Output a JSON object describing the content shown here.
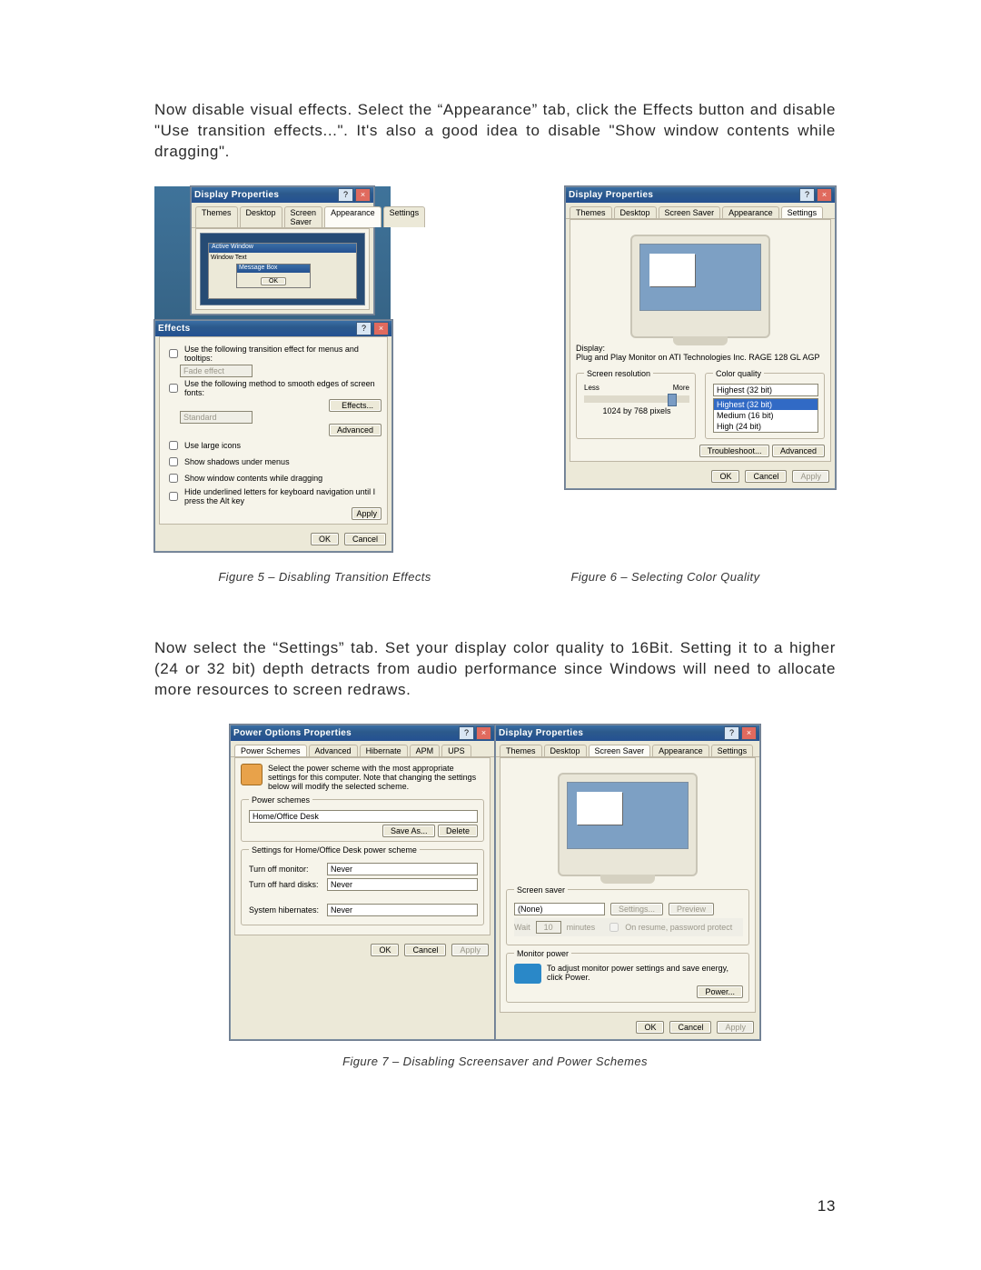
{
  "paragraph1": "Now disable visual effects.  Select the “Appearance” tab, click the Effects button and disable \"Use transition effects...\".  It's also a good idea to disable \"Show window contents while dragging\".",
  "paragraph2": "Now select the “Settings” tab.  Set your display color quality to 16Bit.   Setting it to a higher (24 or 32 bit) depth detracts from audio performance since Windows will need to allocate more resources to screen redraws.",
  "fig5": {
    "caption": "Figure 5 – Disabling Transition Effects",
    "props_title": "Display Properties",
    "tabs": [
      "Themes",
      "Desktop",
      "Screen Saver",
      "Appearance",
      "Settings"
    ],
    "active_tab": "Appearance",
    "preview_active_window": "Active Window",
    "preview_text": "Window Text",
    "preview_msg": "Message Box",
    "btn_ok": "OK",
    "effects": {
      "title": "Effects",
      "chk1": "Use the following transition effect for menus and tooltips:",
      "dd1": "Fade effect",
      "chk2": "Use the following method to smooth edges of screen fonts:",
      "dd2": "Standard",
      "chk3": "Use large icons",
      "chk4": "Show shadows under menus",
      "chk5": "Show window contents while dragging",
      "chk6": "Hide underlined letters for keyboard navigation until I press the Alt key",
      "btn_effects": "Effects...",
      "btn_advanced": "Advanced"
    },
    "ok": "OK",
    "cancel": "Cancel",
    "apply": "Apply"
  },
  "fig6": {
    "caption": "Figure 6 – Selecting Color Quality",
    "title": "Display Properties",
    "tabs": [
      "Themes",
      "Desktop",
      "Screen Saver",
      "Appearance",
      "Settings"
    ],
    "active_tab": "Settings",
    "display_lbl": "Display:",
    "display_value": "Plug and Play Monitor on ATI Technologies Inc. RAGE 128 GL AGP",
    "res_legend": "Screen resolution",
    "res_less": "Less",
    "res_more": "More",
    "res_value": "1024 by 768 pixels",
    "cq_legend": "Color quality",
    "cq_options": [
      "Highest (32 bit)",
      "Medium (16 bit)",
      "High (24 bit)",
      "Highest (32 bit)"
    ],
    "cq_selected": "Highest (32 bit)",
    "btn_troubleshoot": "Troubleshoot...",
    "btn_advanced": "Advanced",
    "ok": "OK",
    "cancel": "Cancel",
    "apply": "Apply"
  },
  "fig7": {
    "caption": "Figure 7 – Disabling Screensaver and Power Schemes",
    "power": {
      "title": "Power Options Properties",
      "tabs": [
        "Power Schemes",
        "Advanced",
        "Hibernate",
        "APM",
        "UPS"
      ],
      "active_tab": "Power Schemes",
      "hint": "Select the power scheme with the most appropriate settings for this computer. Note that changing the settings below will modify the selected scheme.",
      "schemes_legend": "Power schemes",
      "scheme": "Home/Office Desk",
      "save_as": "Save As...",
      "delete": "Delete",
      "settings_legend": "Settings for Home/Office Desk power scheme",
      "l_monitor": "Turn off monitor:",
      "v_monitor": "Never",
      "l_disks": "Turn off hard disks:",
      "v_disks": "Never",
      "l_hib": "System hibernates:",
      "v_hib": "Never",
      "ok": "OK",
      "cancel": "Cancel",
      "apply": "Apply"
    },
    "display": {
      "title": "Display Properties",
      "tabs": [
        "Themes",
        "Desktop",
        "Screen Saver",
        "Appearance",
        "Settings"
      ],
      "active_tab": "Screen Saver",
      "ss_legend": "Screen saver",
      "ss_value": "(None)",
      "settings": "Settings...",
      "preview": "Preview",
      "wait_lbl": "Wait",
      "wait_value": "10",
      "wait_min": "minutes",
      "pwd_chk": "On resume, password protect",
      "mp_legend": "Monitor power",
      "mp_hint": "To adjust monitor power settings and save energy, click Power.",
      "btn_power": "Power...",
      "ok": "OK",
      "cancel": "Cancel",
      "apply": "Apply"
    }
  },
  "page_number": "13"
}
